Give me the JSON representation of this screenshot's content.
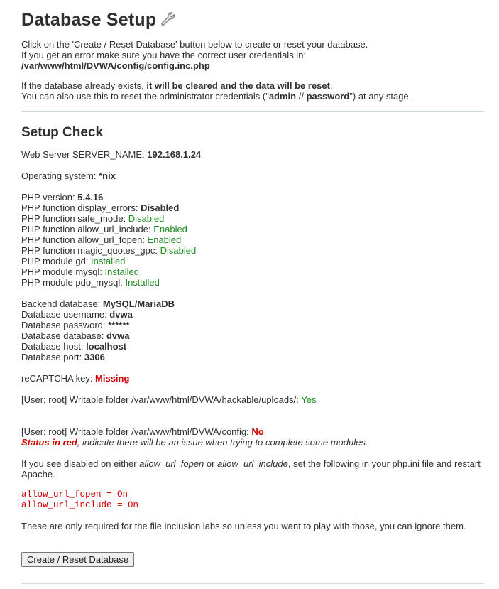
{
  "title": "Database Setup",
  "intro": {
    "line1": "Click on the 'Create / Reset Database' button below to create or reset your database.",
    "line2": "If you get an error make sure you have the correct user credentials in:",
    "config_path": "/var/www/html/DVWA/config/config.inc.php"
  },
  "reset_note": {
    "line1_prefix": "If the database already exists, ",
    "line1_bold": "it will be cleared and the data will be reset",
    "line1_suffix": ".",
    "line2_prefix": "You can also use this to reset the administrator credentials (\"",
    "admin": "admin",
    "sep": " // ",
    "password": "password",
    "line2_suffix": "\") at any stage."
  },
  "setup_check": {
    "heading": "Setup Check",
    "server_name": {
      "label": "Web Server SERVER_NAME: ",
      "value": "192.168.1.24"
    },
    "os": {
      "label": "Operating system: ",
      "value": "*nix"
    },
    "php_version": {
      "label": "PHP version: ",
      "value": "5.4.16"
    },
    "php_items": [
      {
        "label": "PHP function display_errors: ",
        "value": "Disabled",
        "status": "bold"
      },
      {
        "label": "PHP function safe_mode: ",
        "value": "Disabled",
        "status": "green"
      },
      {
        "label": "PHP function allow_url_include: ",
        "value": "Enabled",
        "status": "green"
      },
      {
        "label": "PHP function allow_url_fopen: ",
        "value": "Enabled",
        "status": "green"
      },
      {
        "label": "PHP function magic_quotes_gpc: ",
        "value": "Disabled",
        "status": "green"
      },
      {
        "label": "PHP module gd: ",
        "value": "Installed",
        "status": "green"
      },
      {
        "label": "PHP module mysql: ",
        "value": "Installed",
        "status": "green"
      },
      {
        "label": "PHP module pdo_mysql: ",
        "value": "Installed",
        "status": "green"
      }
    ],
    "db_items": [
      {
        "label": "Backend database: ",
        "value": "MySQL/MariaDB"
      },
      {
        "label": "Database username: ",
        "value": "dvwa"
      },
      {
        "label": "Database password: ",
        "value": "******"
      },
      {
        "label": "Database database: ",
        "value": "dvwa"
      },
      {
        "label": "Database host: ",
        "value": "localhost"
      },
      {
        "label": "Database port: ",
        "value": "3306"
      }
    ],
    "recaptcha": {
      "label": "reCAPTCHA key: ",
      "value": "Missing"
    },
    "uploads_folder": {
      "label": "[User: root] Writable folder /var/www/html/DVWA/hackable/uploads/: ",
      "value": "Yes"
    },
    "config_folder": {
      "label": "[User: root] Writable folder /var/www/html/DVWA/config: ",
      "value": "No"
    },
    "status_note": {
      "bold": "Status in red",
      "rest": ", indicate there will be an issue when trying to complete some modules."
    },
    "disabled_note": {
      "prefix": "If you see disabled on either ",
      "opt1": "allow_url_fopen",
      "mid": " or ",
      "opt2": "allow_url_include",
      "suffix": ", set the following in your php.ini file and restart",
      "line2": "Apache."
    },
    "code_lines": [
      "allow_url_fopen = On",
      "allow_url_include = On"
    ],
    "inclusion_note": "These are only required for the file inclusion labs so unless you want to play with those, you can ignore them."
  },
  "create_button": "Create / Reset Database"
}
